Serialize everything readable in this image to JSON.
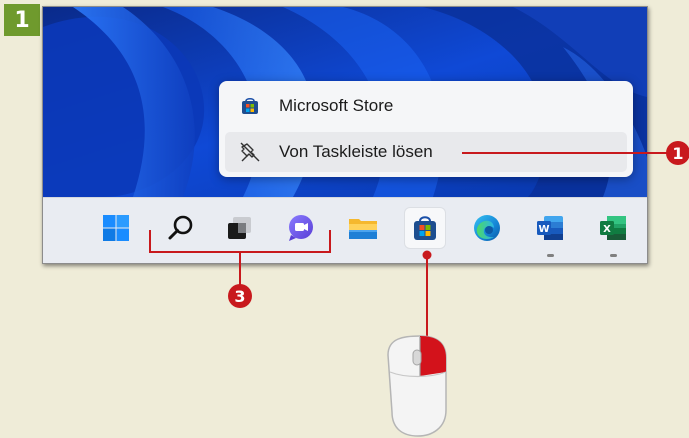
{
  "step": {
    "number": "1"
  },
  "context_menu": {
    "items": [
      {
        "label": "Microsoft Store",
        "icon": "store-icon"
      },
      {
        "label": "Von Taskleiste lösen",
        "icon": "unpin-icon"
      }
    ]
  },
  "taskbar": {
    "icons": [
      {
        "name": "windows-start-icon"
      },
      {
        "name": "search-icon"
      },
      {
        "name": "task-view-icon"
      },
      {
        "name": "chat-icon"
      },
      {
        "name": "file-explorer-icon"
      },
      {
        "name": "microsoft-store-icon",
        "state": "active"
      },
      {
        "name": "edge-icon"
      },
      {
        "name": "word-icon",
        "running": true
      },
      {
        "name": "excel-icon",
        "running": true
      }
    ]
  },
  "callouts": {
    "first": "1",
    "third": "3"
  },
  "colors": {
    "callout_red": "#c8191d",
    "step_badge_green": "#6f9a2d",
    "background": "#efecd8"
  }
}
